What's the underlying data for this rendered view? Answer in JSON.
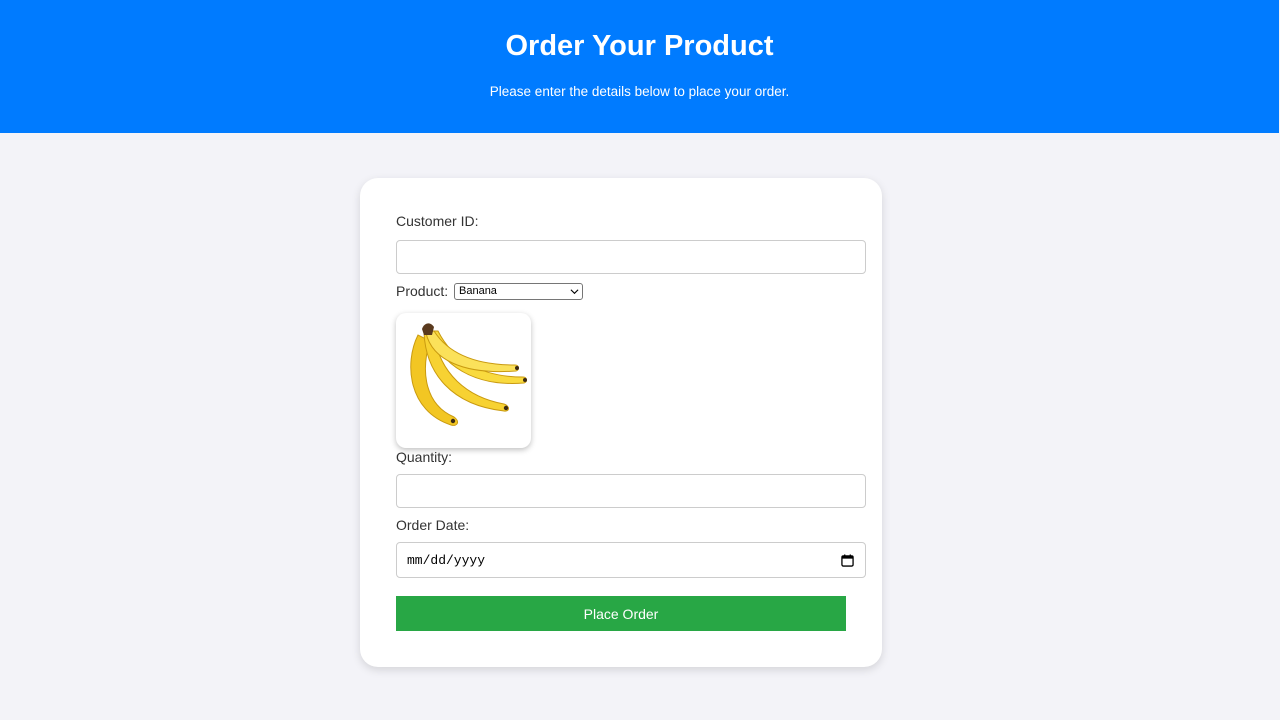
{
  "header": {
    "title": "Order Your Product",
    "subtitle": "Please enter the details below to place your order."
  },
  "form": {
    "customer_id": {
      "label": "Customer ID:",
      "value": ""
    },
    "product": {
      "label": "Product:",
      "selected": "Banana",
      "image_icon": "banana-image"
    },
    "quantity": {
      "label": "Quantity:",
      "value": ""
    },
    "order_date": {
      "label": "Order Date:",
      "placeholder": "mm/dd/yyyy",
      "icon": "calendar-icon"
    },
    "submit_label": "Place Order"
  },
  "colors": {
    "header_bg": "#007bff",
    "submit_bg": "#28a745",
    "page_bg": "#f3f3f8"
  }
}
